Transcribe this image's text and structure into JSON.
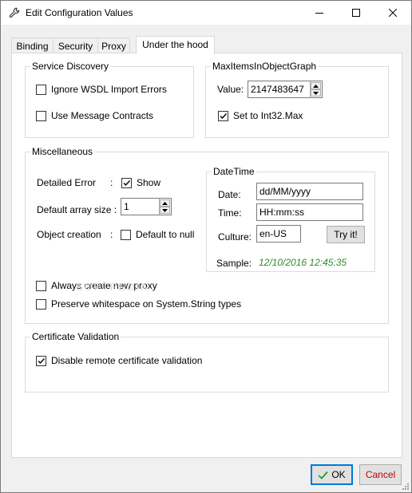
{
  "window": {
    "title": "Edit Configuration Values"
  },
  "tabs": [
    {
      "label": "Binding"
    },
    {
      "label": "Security"
    },
    {
      "label": "Proxy"
    },
    {
      "label": "Under the hood",
      "active": true
    }
  ],
  "service_discovery": {
    "title": "Service Discovery",
    "ignore_wsdl": {
      "label": "Ignore WSDL Import Errors",
      "checked": false
    },
    "use_message_contracts": {
      "label": "Use Message Contracts",
      "checked": false
    }
  },
  "max_items": {
    "title": "MaxItemsInObjectGraph",
    "value_label": "Value:",
    "value": "2147483647",
    "set_int32": {
      "label": "Set to Int32.Max",
      "checked": true
    }
  },
  "misc": {
    "title": "Miscellaneous",
    "detailed_error_label": "Detailed Error",
    "detailed_error_colon": ":",
    "show": {
      "label": "Show",
      "checked": true
    },
    "array_size_label": "Default array size :",
    "array_size_value": "1",
    "object_creation_label": "Object creation",
    "object_creation_colon": ":",
    "default_null": {
      "label": "Default to null",
      "checked": false
    },
    "always_new_proxy": {
      "label": "Always create new proxy",
      "checked": false
    },
    "preserve_whitespace": {
      "label": "Preserve whitespace on System.String types",
      "checked": false
    }
  },
  "datetime": {
    "title": "DateTime",
    "date_label": "Date:",
    "date_value": "dd/MM/yyyy",
    "time_label": "Time:",
    "time_value": "HH:mm:ss",
    "culture_label": "Culture:",
    "culture_value": "en-US",
    "try_label": "Try it!",
    "sample_label": "Sample:",
    "sample_value": "12/10/2016 12:45:35"
  },
  "cert": {
    "title": "Certificate Validation",
    "disable_remote": {
      "label": "Disable remote certificate validation",
      "checked": true
    }
  },
  "footer": {
    "ok_label": "OK",
    "cancel_label": "Cancel"
  },
  "watermark": "SOFTPEDIA",
  "colors": {
    "sample_green": "#2e8b2e",
    "cancel_red": "#c00000",
    "ok_border": "#0078d7",
    "ok_check": "#1e9e1e"
  }
}
